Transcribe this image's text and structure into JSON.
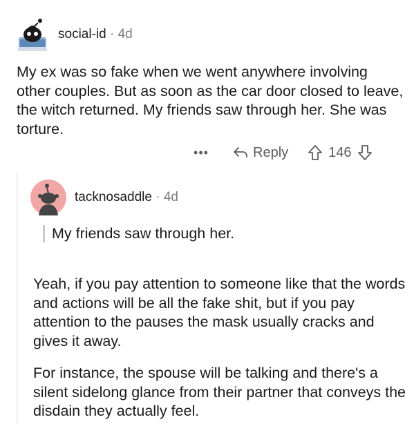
{
  "post": {
    "author": "social-id",
    "age": "4d",
    "body": "My ex was so fake when we went anywhere involving other couples. But as soon as the car door closed to leave, the witch returned. My friends saw through her. She was torture.",
    "actions": {
      "more_label": "•••",
      "reply_label": "Reply",
      "vote_count": "146"
    }
  },
  "reply": {
    "author": "tacknosaddle",
    "age": "4d",
    "quote": "My friends saw through her.",
    "paragraphs": [
      "Yeah, if you pay attention to someone like that the words and actions will be all the fake shit, but if you pay attention to the pauses the mask usually cracks and gives it away.",
      "For instance, the spouse will be talking and there's a silent sidelong glance from their partner that conveys the disdain they actually feel."
    ]
  },
  "icons": {
    "reply": "reply-arrow-icon",
    "upvote": "upvote-arrow-icon",
    "downvote": "downvote-arrow-icon",
    "avatar1": "snoo-avatar-icon",
    "avatar2": "snoo-avatar-icon"
  },
  "colors": {
    "avatar2_bg": "#f2a7a7",
    "meta_text": "#7c7c7c",
    "action_text": "#5c5c5c"
  }
}
